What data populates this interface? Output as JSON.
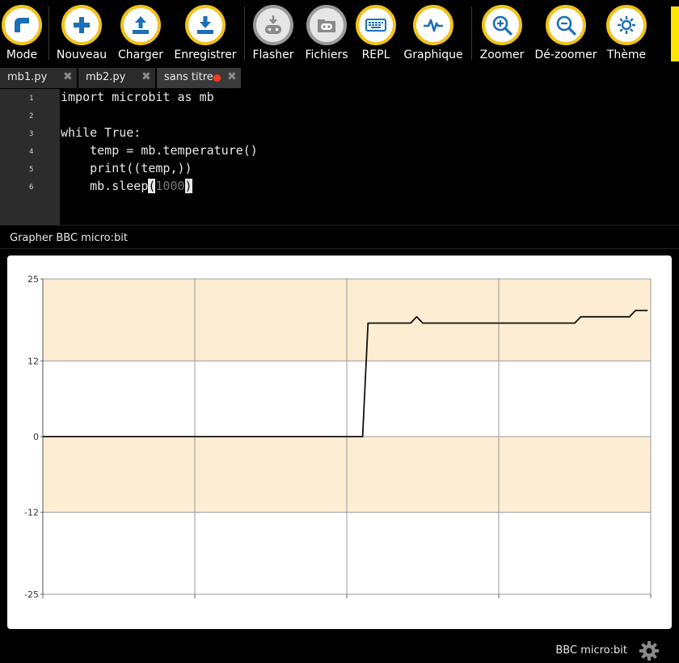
{
  "toolbar": {
    "mode": "Mode",
    "new": "Nouveau",
    "load": "Charger",
    "save": "Enregistrer",
    "flash": "Flasher",
    "files": "Fichiers",
    "repl": "REPL",
    "plotter": "Graphique",
    "zoom_in": "Zoomer",
    "zoom_out": "Dé-zoomer",
    "theme": "Thème"
  },
  "tabs": [
    {
      "label": "mb1.py"
    },
    {
      "label": "mb2.py"
    },
    {
      "label": "sans titre"
    }
  ],
  "editor": {
    "line_numbers": [
      "1",
      "2",
      "3",
      "4",
      "5",
      "6"
    ],
    "lines": {
      "l1": "import microbit as mb",
      "l3": "while True:",
      "l4": "    temp = mb.temperature()",
      "l5": "    print((temp,))",
      "l6_a": "    mb.sleep",
      "l6_open": "(",
      "l6_num": "1000",
      "l6_close": ")"
    }
  },
  "plotter": {
    "title": "Grapher BBC micro:bit"
  },
  "status": {
    "device": "BBC micro:bit"
  },
  "colors": {
    "accent": "#f2c21b",
    "band": "#fdeed3",
    "tab_modified_dot": "#ff3b1f"
  },
  "chart_data": {
    "type": "line",
    "ylim": [
      -25,
      25
    ],
    "yticks": [
      "25",
      "12",
      "0",
      "-12",
      "-25"
    ],
    "xlim": [
      0,
      100
    ],
    "grid": true,
    "series": [
      {
        "points": [
          [
            0,
            0
          ],
          [
            52.6,
            0
          ],
          [
            53.5,
            18
          ],
          [
            60.5,
            18
          ],
          [
            61.5,
            19
          ],
          [
            62.5,
            18
          ],
          [
            87.5,
            18
          ],
          [
            88.5,
            19
          ],
          [
            96.5,
            19
          ],
          [
            97.5,
            20
          ],
          [
            99.5,
            20
          ]
        ]
      }
    ]
  }
}
